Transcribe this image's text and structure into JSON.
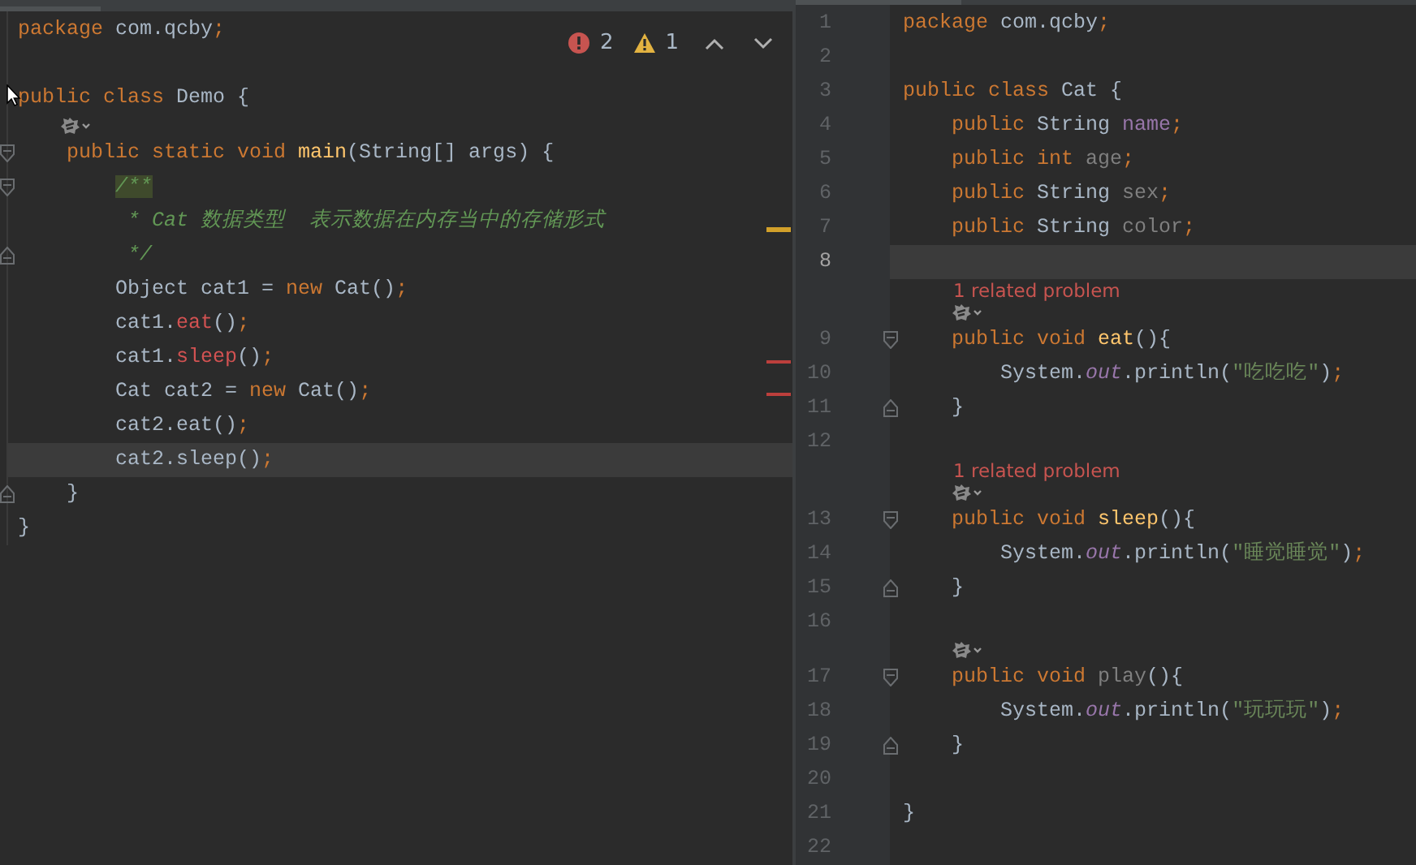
{
  "left_editor": {
    "inspection": {
      "errors": "2",
      "warnings": "1"
    },
    "lines": [
      {
        "kind": "code",
        "current": false,
        "tokens": [
          {
            "text": "package",
            "kind": "kw"
          },
          {
            "text": " com.qcby",
            "kind": "plain"
          },
          {
            "text": ";",
            "kind": "semi"
          }
        ]
      },
      {
        "kind": "blank",
        "current": false
      },
      {
        "kind": "code",
        "current": false,
        "tokens": [
          {
            "text": "public class",
            "kind": "kw"
          },
          {
            "text": " Demo {",
            "kind": "plain"
          }
        ]
      },
      {
        "kind": "hint"
      },
      {
        "kind": "code",
        "current": false,
        "fold": {
          "kind": "start"
        },
        "tokens": [
          {
            "text": "    public static void ",
            "kind": "kw"
          },
          {
            "text": "main",
            "kind": "decl"
          },
          {
            "text": "(String[] args) {",
            "kind": "plain"
          }
        ]
      },
      {
        "kind": "code",
        "current": false,
        "fold": {
          "kind": "start"
        },
        "tokens": [
          {
            "text": "        /**",
            "kind": "dochl"
          }
        ]
      },
      {
        "kind": "code",
        "current": false,
        "tokens": [
          {
            "text": "         * Cat 数据类型  表示数据在内存当中的存储形式",
            "kind": "doc"
          }
        ]
      },
      {
        "kind": "code",
        "current": false,
        "fold": {
          "kind": "end"
        },
        "tokens": [
          {
            "text": "         */",
            "kind": "doc"
          }
        ]
      },
      {
        "kind": "code",
        "current": false,
        "tokens": [
          {
            "text": "        Object cat1 = ",
            "kind": "plain"
          },
          {
            "text": "new",
            "kind": "kw"
          },
          {
            "text": " Cat()",
            "kind": "plain"
          },
          {
            "text": ";",
            "kind": "semi"
          }
        ]
      },
      {
        "kind": "code",
        "current": false,
        "tokens": [
          {
            "text": "        cat1.",
            "kind": "plain"
          },
          {
            "text": "eat",
            "kind": "err"
          },
          {
            "text": "()",
            "kind": "plain"
          },
          {
            "text": ";",
            "kind": "semi"
          }
        ]
      },
      {
        "kind": "code",
        "current": false,
        "tokens": [
          {
            "text": "        cat1.",
            "kind": "plain"
          },
          {
            "text": "sleep",
            "kind": "err"
          },
          {
            "text": "()",
            "kind": "plain"
          },
          {
            "text": ";",
            "kind": "semi"
          }
        ]
      },
      {
        "kind": "code",
        "current": false,
        "tokens": [
          {
            "text": "        Cat cat2 = ",
            "kind": "plain"
          },
          {
            "text": "new",
            "kind": "kw"
          },
          {
            "text": " Cat()",
            "kind": "plain"
          },
          {
            "text": ";",
            "kind": "semi"
          }
        ]
      },
      {
        "kind": "code",
        "current": false,
        "tokens": [
          {
            "text": "        cat2.eat()",
            "kind": "plain"
          },
          {
            "text": ";",
            "kind": "semi"
          }
        ]
      },
      {
        "kind": "code",
        "current": true,
        "tokens": [
          {
            "text": "        cat2.sleep()",
            "kind": "plain"
          },
          {
            "text": ";",
            "kind": "semi"
          }
        ]
      },
      {
        "kind": "code",
        "current": false,
        "fold": {
          "kind": "end"
        },
        "tokens": [
          {
            "text": "    }",
            "kind": "plain"
          }
        ]
      },
      {
        "kind": "code",
        "current": false,
        "tokens": [
          {
            "text": "}",
            "kind": "plain"
          }
        ]
      }
    ]
  },
  "right_editor": {
    "lines": [
      {
        "kind": "code",
        "number": "1",
        "current": false,
        "tokens": [
          {
            "text": "package",
            "kind": "kw"
          },
          {
            "text": " com.qcby",
            "kind": "plain"
          },
          {
            "text": ";",
            "kind": "semi"
          }
        ]
      },
      {
        "kind": "blank",
        "number": "2",
        "current": false
      },
      {
        "kind": "code",
        "number": "3",
        "current": false,
        "tokens": [
          {
            "text": "public class",
            "kind": "kw"
          },
          {
            "text": " Cat {",
            "kind": "plain"
          }
        ]
      },
      {
        "kind": "code",
        "number": "4",
        "current": false,
        "tokens": [
          {
            "text": "    public",
            "kind": "kw"
          },
          {
            "text": " String ",
            "kind": "plain"
          },
          {
            "text": "name",
            "kind": "field"
          },
          {
            "text": ";",
            "kind": "semi"
          }
        ]
      },
      {
        "kind": "code",
        "number": "5",
        "current": false,
        "tokens": [
          {
            "text": "    public int ",
            "kind": "kw"
          },
          {
            "text": "age",
            "kind": "unused"
          },
          {
            "text": ";",
            "kind": "semi"
          }
        ]
      },
      {
        "kind": "code",
        "number": "6",
        "current": false,
        "tokens": [
          {
            "text": "    public",
            "kind": "kw"
          },
          {
            "text": " String ",
            "kind": "plain"
          },
          {
            "text": "sex",
            "kind": "unused"
          },
          {
            "text": ";",
            "kind": "semi"
          }
        ]
      },
      {
        "kind": "code",
        "number": "7",
        "current": false,
        "tokens": [
          {
            "text": "    public",
            "kind": "kw"
          },
          {
            "text": " String ",
            "kind": "plain"
          },
          {
            "text": "color",
            "kind": "unused"
          },
          {
            "text": ";",
            "kind": "semi"
          }
        ]
      },
      {
        "kind": "blank",
        "number": "8",
        "current": true
      },
      {
        "kind": "problem",
        "text": "1 related problem"
      },
      {
        "kind": "hint"
      },
      {
        "kind": "code",
        "number": "9",
        "current": false,
        "fold": {
          "kind": "start"
        },
        "tokens": [
          {
            "text": "    public void ",
            "kind": "kw"
          },
          {
            "text": "eat",
            "kind": "decl"
          },
          {
            "text": "(){",
            "kind": "plain"
          }
        ]
      },
      {
        "kind": "code",
        "number": "10",
        "current": false,
        "tokens": [
          {
            "text": "        System.",
            "kind": "plain"
          },
          {
            "text": "out",
            "kind": "static"
          },
          {
            "text": ".println(",
            "kind": "plain"
          },
          {
            "text": "\"吃吃吃\"",
            "kind": "str"
          },
          {
            "text": ")",
            "kind": "plain"
          },
          {
            "text": ";",
            "kind": "semi"
          }
        ]
      },
      {
        "kind": "code",
        "number": "11",
        "current": false,
        "fold": {
          "kind": "end"
        },
        "tokens": [
          {
            "text": "    }",
            "kind": "plain"
          }
        ]
      },
      {
        "kind": "blank",
        "number": "12",
        "current": false
      },
      {
        "kind": "problem",
        "text": "1 related problem"
      },
      {
        "kind": "hint"
      },
      {
        "kind": "code",
        "number": "13",
        "current": false,
        "fold": {
          "kind": "start"
        },
        "tokens": [
          {
            "text": "    public void ",
            "kind": "kw"
          },
          {
            "text": "sleep",
            "kind": "decl"
          },
          {
            "text": "(){",
            "kind": "plain"
          }
        ]
      },
      {
        "kind": "code",
        "number": "14",
        "current": false,
        "tokens": [
          {
            "text": "        System.",
            "kind": "plain"
          },
          {
            "text": "out",
            "kind": "static"
          },
          {
            "text": ".println(",
            "kind": "plain"
          },
          {
            "text": "\"睡觉睡觉\"",
            "kind": "str"
          },
          {
            "text": ")",
            "kind": "plain"
          },
          {
            "text": ";",
            "kind": "semi"
          }
        ]
      },
      {
        "kind": "code",
        "number": "15",
        "current": false,
        "fold": {
          "kind": "end"
        },
        "tokens": [
          {
            "text": "    }",
            "kind": "plain"
          }
        ]
      },
      {
        "kind": "blank",
        "number": "16",
        "current": false
      },
      {
        "kind": "hint"
      },
      {
        "kind": "code",
        "number": "17",
        "current": false,
        "fold": {
          "kind": "start"
        },
        "tokens": [
          {
            "text": "    public void ",
            "kind": "kw"
          },
          {
            "text": "play",
            "kind": "unused"
          },
          {
            "text": "(){",
            "kind": "plain"
          }
        ]
      },
      {
        "kind": "code",
        "number": "18",
        "current": false,
        "tokens": [
          {
            "text": "        System.",
            "kind": "plain"
          },
          {
            "text": "out",
            "kind": "static"
          },
          {
            "text": ".println(",
            "kind": "plain"
          },
          {
            "text": "\"玩玩玩\"",
            "kind": "str"
          },
          {
            "text": ")",
            "kind": "plain"
          },
          {
            "text": ";",
            "kind": "semi"
          }
        ]
      },
      {
        "kind": "code",
        "number": "19",
        "current": false,
        "fold": {
          "kind": "end"
        },
        "tokens": [
          {
            "text": "    }",
            "kind": "plain"
          }
        ]
      },
      {
        "kind": "blank",
        "number": "20",
        "current": false
      },
      {
        "kind": "code",
        "number": "21",
        "current": false,
        "tokens": [
          {
            "text": "}",
            "kind": "plain"
          }
        ]
      },
      {
        "kind": "blank",
        "number": "22",
        "current": false
      }
    ]
  }
}
